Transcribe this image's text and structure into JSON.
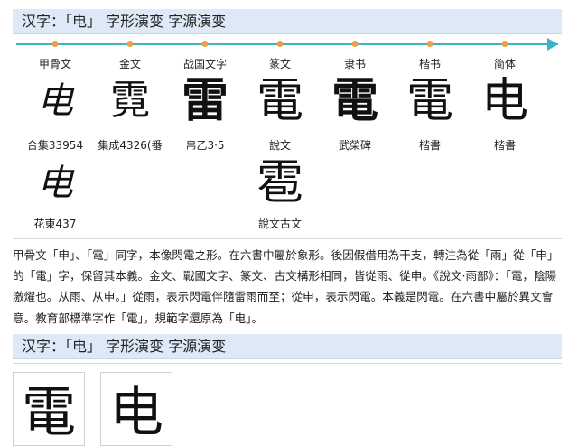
{
  "headers": [
    {
      "prefix": "汉字：",
      "char": "「电」",
      "title": "字形演变 字源演变"
    },
    {
      "prefix": "汉字：",
      "char": "「电」",
      "title": "字形演变 字源演变"
    }
  ],
  "timeline": {
    "columns": [
      {
        "label": "甲骨文",
        "glyph": "电",
        "source": "合集33954"
      },
      {
        "label": "金文",
        "glyph": "霓",
        "source": "集成4326(番"
      },
      {
        "label": "战国文字",
        "glyph": "雷",
        "source": "帛乙3·5"
      },
      {
        "label": "篆文",
        "glyph": "電",
        "source": "說文"
      },
      {
        "label": "隶书",
        "glyph": "電",
        "source": "武榮碑"
      },
      {
        "label": "楷书",
        "glyph": "電",
        "source": "楷書"
      },
      {
        "label": "简体",
        "glyph": "电",
        "source": "楷書"
      }
    ],
    "extra": [
      {
        "glyph": "电",
        "source": "花東437"
      },
      {
        "glyph": "雹",
        "source": "說文古文"
      }
    ]
  },
  "paragraph": "甲骨文「申」、「電」同字，本像閃電之形。在六書中屬於象形。後因假借用為干支，轉注為從「雨」從「申」的「電」字，保留其本義。金文、戰國文字、篆文、古文構形相同，皆從雨、從申。《說文·雨部》：「電，陰陽激燿也。从雨、从申。」從雨，表示閃電伴隨雷雨而至；從申，表示閃電。本義是閃電。在六書中屬於異文會意。教育部標準字作「電」，規範字還原為「电」。",
  "bottom_boxes": [
    {
      "glyph": "電"
    },
    {
      "glyph": "电"
    }
  ],
  "colors": {
    "header_bg": "#dde9f6",
    "timeline": "#3bb3c4",
    "dot": "#f39c4a"
  }
}
